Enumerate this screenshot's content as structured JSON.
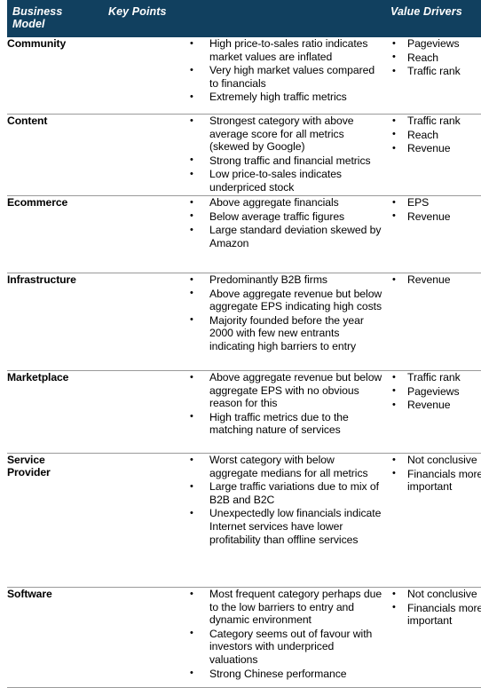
{
  "table": {
    "columns": [
      {
        "key": "business_model",
        "label": "Business\nModel"
      },
      {
        "key": "key_points",
        "label": "Key Points"
      },
      {
        "key": "value_drivers",
        "label": "Value Drivers"
      }
    ],
    "header": {
      "business_model_line1": "Business",
      "business_model_line2": "Model",
      "key_points": "Key Points",
      "value_drivers": "Value Drivers"
    },
    "header_background": "#11405F",
    "header_text_color": "#FFFFFF",
    "border_color": "#9A9A9A",
    "rows": [
      {
        "model": "Community",
        "key_points": [
          "High price-to-sales ratio indicates market values are inflated",
          "Very high market values compared to financials",
          "Extremely high traffic metrics"
        ],
        "value_drivers": [
          "Pageviews",
          "Reach",
          "Traffic rank"
        ]
      },
      {
        "model": "Content",
        "key_points": [
          "Strongest category with above average score for all metrics (skewed by Google)",
          "Strong traffic and financial metrics",
          "Low price-to-sales indicates underpriced stock"
        ],
        "value_drivers": [
          "Traffic rank",
          "Reach",
          "Revenue"
        ]
      },
      {
        "model": "Ecommerce",
        "key_points": [
          "Above aggregate financials",
          "Below average traffic figures",
          "Large standard deviation skewed by Amazon"
        ],
        "value_drivers": [
          "EPS",
          "Revenue"
        ]
      },
      {
        "model": "Infrastructure",
        "key_points": [
          "Predominantly B2B firms",
          "Above aggregate revenue but below aggregate EPS indicating high costs",
          "Majority founded before the year 2000 with few new entrants indicating high barriers to entry"
        ],
        "value_drivers": [
          "Revenue"
        ]
      },
      {
        "model": "Marketplace",
        "key_points": [
          "Above aggregate revenue but below aggregate EPS with no obvious reason for this",
          "High traffic metrics due to the matching nature of services"
        ],
        "value_drivers": [
          "Traffic rank",
          "Pageviews",
          "Revenue"
        ]
      },
      {
        "model": "Service Provider",
        "model_line1": "Service",
        "model_line2": "Provider",
        "key_points": [
          "Worst category with below aggregate medians for all metrics",
          "Large traffic variations due to mix of B2B and B2C",
          "Unexpectedly low financials indicate Internet services have lower profitability than offline services"
        ],
        "value_drivers": [
          "Not conclusive",
          "Financials more important"
        ]
      },
      {
        "model": "Software",
        "key_points": [
          "Most frequent category perhaps due to the low barriers to entry and dynamic environment",
          "Category seems out of favour with investors with underpriced valuations",
          "Strong Chinese performance"
        ],
        "value_drivers": [
          "Not conclusive",
          "Financials more important"
        ]
      }
    ]
  }
}
